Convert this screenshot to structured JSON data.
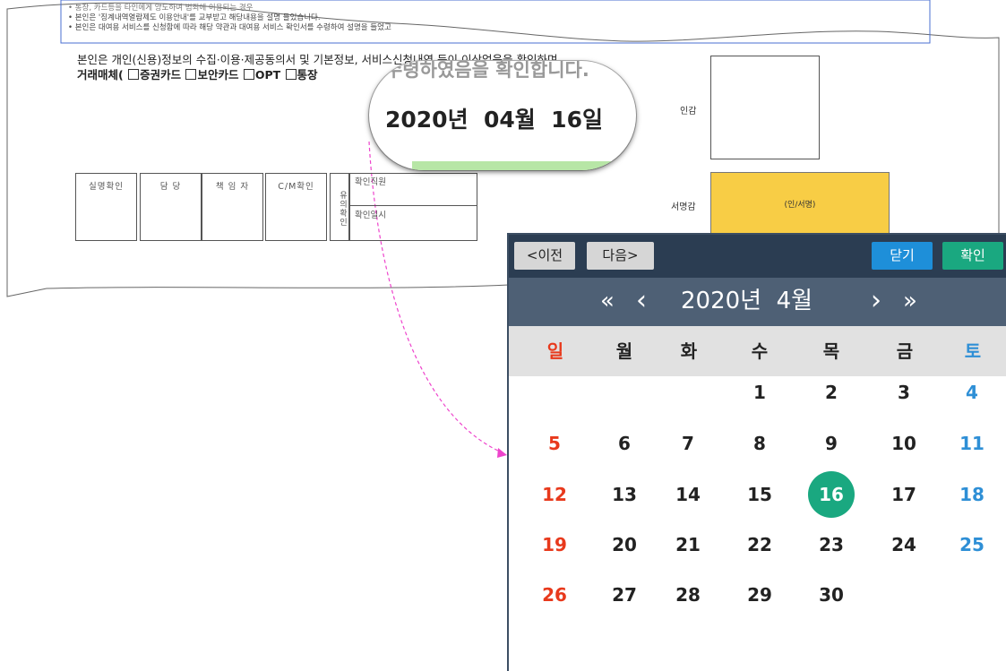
{
  "document": {
    "notes": [
      "• 통장, 카드등을 타인에게 양도하여 범죄에 이용되는 경우",
      "• 본인은 '징계내역열람제도 이용안내'를 교부받고 해당내용을 설명 들었습니다.",
      "• 본인은 대여용 서비스를 신청함에 따라 해당 약관과 대여용 서비스 확인서를 수령하여 설명을 들었고"
    ],
    "consent_line": "본인은 개인(신용)정보의 수집·이용·제공동의서 및 기본정보, 서비스신청내역 등이 이상없음을 확인하며,",
    "media_prefix": "거래매체(",
    "media_options": [
      "증권카드",
      "보안카드",
      "OPT",
      "통장"
    ],
    "confirm_tail": "수령하였음을 확인합니다.",
    "date_text": "2020년  04월  16일",
    "seal_label": "인감",
    "signature_label": "서명감",
    "signature_placeholder": "(인/서명)",
    "approval_cells": [
      "실명확인",
      "담  당",
      "책 임 자",
      "C/M확인"
    ],
    "reviewer_label": "유의확인",
    "reviewer_staff": "확인직원",
    "reviewer_date": "확인일시"
  },
  "calendar": {
    "toolbar": {
      "prev_label": "<이전",
      "next_label": "다음>",
      "close_label": "닫기",
      "ok_label": "확인"
    },
    "nav": {
      "prev_year": "«",
      "prev_month": "‹",
      "title": "2020년  4월",
      "next_month": "›",
      "next_year": "»"
    },
    "weekdays": [
      "일",
      "월",
      "화",
      "수",
      "목",
      "금",
      "토"
    ],
    "weeks": [
      [
        "",
        "",
        "",
        "1",
        "2",
        "3",
        "4"
      ],
      [
        "5",
        "6",
        "7",
        "8",
        "9",
        "10",
        "11"
      ],
      [
        "12",
        "13",
        "14",
        "15",
        "16",
        "17",
        "18"
      ],
      [
        "19",
        "20",
        "21",
        "22",
        "23",
        "24",
        "25"
      ],
      [
        "26",
        "27",
        "28",
        "29",
        "30",
        "",
        ""
      ]
    ],
    "selected_day": "16",
    "colors": {
      "toolbar_bg": "#2b3d52",
      "header_bg": "#4e6075",
      "weekday_bg": "#e1e1e1",
      "close_btn": "#1e8fd9",
      "ok_btn": "#1aa880",
      "sunday": "#e8391c",
      "saturday": "#2e8fd6",
      "selected": "#1aa880",
      "arrow": "#ee44cc",
      "signature_box": "#f8cd45"
    }
  }
}
